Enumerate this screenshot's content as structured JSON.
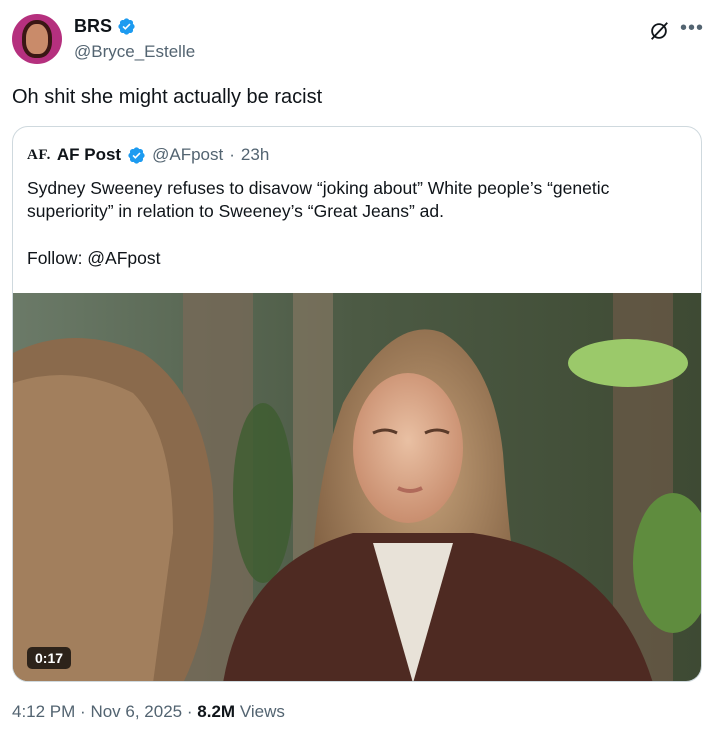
{
  "author": {
    "name": "BRS",
    "handle": "@Bryce_Estelle",
    "avatar_icon": "profile-avatar",
    "verified": true
  },
  "tweet": {
    "text": "Oh shit she might actually be racist"
  },
  "quoted": {
    "logo_text": "AF.",
    "name": "AF Post",
    "handle": "@AFpost",
    "separator": "·",
    "time": "23h",
    "verified": true,
    "body_line": "Sydney Sweeney refuses to disavow “joking about” White people’s “genetic superiority” in relation to Sweeney’s “Great Jeans” ad.",
    "follow_line": "Follow: @AFpost",
    "video": {
      "duration": "0:17"
    }
  },
  "footer": {
    "time": "4:12 PM",
    "sep1": "·",
    "date": "Nov 6, 2025",
    "sep2": "·",
    "views_count": "8.2M",
    "views_label": "Views"
  },
  "icons": {
    "verified_color": "#1d9bf0",
    "grok": "grok-icon",
    "more": "more-icon"
  }
}
